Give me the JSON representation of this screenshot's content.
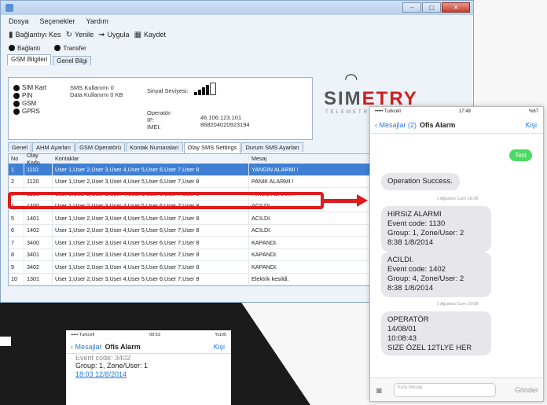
{
  "window": {
    "menu": [
      "Dosya",
      "Seçenekler",
      "Yardım"
    ],
    "toolbar": [
      "Bağlantıyı Kes",
      "Yenile",
      "Uygula",
      "Kaydet"
    ],
    "status_items": [
      "Bağlantı",
      "Transfer"
    ],
    "tabs": [
      "GSM Bilgileri",
      "Genel Bilgi"
    ]
  },
  "gsm": {
    "indicators": [
      "SIM Kart",
      "PIN",
      "GSM",
      "GPRS"
    ],
    "sms_usage": "SMS Kullanımı  0",
    "data_usage": "Data Kullanımı  0 KB",
    "signal_label": "Sinyal Seviyesi:",
    "operator_label": "Operatör:",
    "ip_label": "IP:",
    "imei_label": "IMEI:",
    "ip_value": "46.106.123.101",
    "imei_value": "868204020923194"
  },
  "logo": {
    "brand_a": "SIM",
    "brand_b": "ETRY",
    "subtitle": "TELEMETRY"
  },
  "settings_tabs": [
    "Genel",
    "AHM Ayarları",
    "GSM Operatörü",
    "Kontak Numaraları",
    "Olay SMS Settings",
    "Durum SMS Ayarları"
  ],
  "grid": {
    "headers": [
      "No",
      "Olay Kodu",
      "Kontaklar",
      "Mesaj"
    ],
    "rows": [
      {
        "no": "1",
        "code": "1110",
        "contacts": "User 1,User 2,User 3,User 4,User 5,User 6,User 7,User 8",
        "msg": "YANGIN ALARMI !"
      },
      {
        "no": "2",
        "code": "1120",
        "contacts": "User 1,User 2,User 3,User 4,User 5,User 6,User 7,User 8",
        "msg": "PANIK ALARMI !"
      },
      {
        "no": "3",
        "code": "1130",
        "contacts": "User 1,User 2,User 3,User 4,User 5,User 6,User 7,User 8",
        "msg": "HIRSIZ ALARMI !"
      },
      {
        "no": "4",
        "code": "1400",
        "contacts": "User 1,User 2,User 3,User 4,User 5,User 6,User 7,User 8",
        "msg": "ACILDI."
      },
      {
        "no": "5",
        "code": "1401",
        "contacts": "User 1,User 2,User 3,User 4,User 5,User 6,User 7,User 8",
        "msg": "ACILDI."
      },
      {
        "no": "6",
        "code": "1402",
        "contacts": "User 1,User 2,User 3,User 4,User 5,User 6,User 7,User 8",
        "msg": "ACILDI."
      },
      {
        "no": "7",
        "code": "3400",
        "contacts": "User 1,User 2,User 3,User 4,User 5,User 6,User 7,User 8",
        "msg": "KAPANDI."
      },
      {
        "no": "8",
        "code": "3401",
        "contacts": "User 1,User 2,User 3,User 4,User 5,User 6,User 7,User 8",
        "msg": "KAPANDI."
      },
      {
        "no": "9",
        "code": "3402",
        "contacts": "User 1,User 2,User 3,User 4,User 5,User 6,User 7,User 8",
        "msg": "KAPANDI."
      },
      {
        "no": "10",
        "code": "1301",
        "contacts": "User 1,User 2,User 3,User 4,User 5,User 6,User 7,User 8",
        "msg": "Elektrik kesildi."
      }
    ]
  },
  "phone": {
    "carrier": "••••• Turkcell",
    "time": "17:48",
    "battery": "%67",
    "back": "Mesajlar (2)",
    "title": "Ofis Alarm",
    "contact": "Kişi",
    "sent": "Test",
    "msg1": "Operation Success.",
    "stamp1": "1 Ağustos Cum 18:38",
    "msg2": [
      "HIRSIZ ALARMI",
      "Event code: 1130",
      "Group: 1, Zone/User: 2",
      "8:38 1/8/2014"
    ],
    "msg3": [
      "ACILDI.",
      "Event code: 1402",
      "Group: 4, Zone/User: 2",
      "8:38 1/8/2014"
    ],
    "stamp2": "1 Ağustos Cum 10:08",
    "msg4": [
      "OPERATÖR",
      "14/08/01",
      "10:08:43",
      "SIZE ÖZEL 12TLYE HER"
    ],
    "input_placeholder": "Kutu Mesajı",
    "send": "Gönder"
  },
  "phone2": {
    "carrier": "••••• Turkcell",
    "time": "09:53",
    "battery": "%100",
    "back": "Mesajlar",
    "title": "Ofis Alarm",
    "contact": "Kişi",
    "line1": "Event code: 3402",
    "line2": "Group: 1, Zone/User: 1",
    "link": "18:03 12/8/2014"
  }
}
